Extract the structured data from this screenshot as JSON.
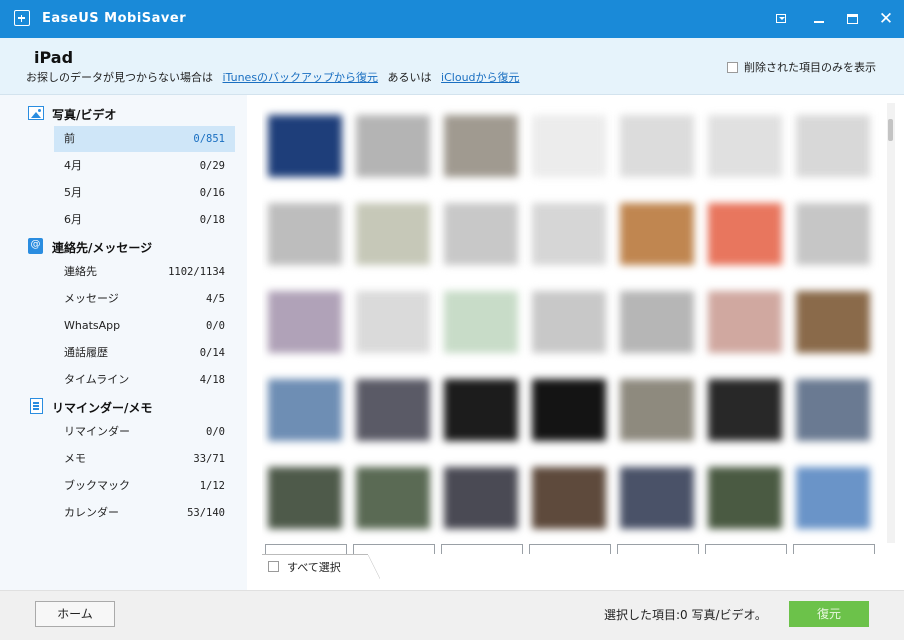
{
  "window": {
    "title": "EaseUS MobiSaver"
  },
  "header": {
    "device": "iPad",
    "hint_prefix": "お探しのデータが見つからない場合は",
    "itunes_link": "iTunesのバックアップから復元",
    "hint_middle": "あるいは",
    "icloud_link": "iCloudから復元",
    "deleted_only_label": "削除された項目のみを表示"
  },
  "sidebar": {
    "categories": [
      {
        "label": "写真/ビデオ",
        "icon": "photo-icon",
        "items": [
          {
            "label": "前",
            "count": "0/851"
          },
          {
            "label": "4月",
            "count": "0/29"
          },
          {
            "label": "5月",
            "count": "0/16"
          },
          {
            "label": "6月",
            "count": "0/18"
          }
        ]
      },
      {
        "label": "連絡先/メッセージ",
        "icon": "contact-icon",
        "items": [
          {
            "label": "連絡先",
            "count": "1102/1134"
          },
          {
            "label": "メッセージ",
            "count": "4/5"
          },
          {
            "label": "WhatsApp",
            "count": "0/0"
          },
          {
            "label": "通話履歴",
            "count": "0/14"
          },
          {
            "label": "タイムライン",
            "count": "4/18"
          }
        ]
      },
      {
        "label": "リマインダー/メモ",
        "icon": "memo-icon",
        "items": [
          {
            "label": "リマインダー",
            "count": "0/0"
          },
          {
            "label": "メモ",
            "count": "33/71"
          },
          {
            "label": "ブックマック",
            "count": "1/12"
          },
          {
            "label": "カレンダー",
            "count": "53/140"
          }
        ]
      }
    ]
  },
  "grid": {
    "thumbnail_colors": [
      [
        "#1e3e7a",
        "#b4b4b4",
        "#a09a90",
        "#ececec",
        "#dcdcdc",
        "#e0e0e0",
        "#d8d8d8"
      ],
      [
        "#bdbdbd",
        "#c6c8b8",
        "#c8c8c8",
        "#d6d6d6",
        "#c08650",
        "#e8765e",
        "#c6c6c6"
      ],
      [
        "#b0a2b8",
        "#dadada",
        "#c8dcc8",
        "#c8c8c8",
        "#b6b6b6",
        "#d0a8a0",
        "#8a6a4a"
      ],
      [
        "#6e8eb4",
        "#5a5a66",
        "#1c1c1c",
        "#141414",
        "#8e8a7e",
        "#282828",
        "#6a7a92"
      ],
      [
        "#4e5a4a",
        "#5a6a54",
        "#4a4a54",
        "#5e4a3c",
        "#4a5268",
        "#4a5a42",
        "#6a94c8"
      ]
    ],
    "select_all_label": "すべて選択"
  },
  "footer": {
    "home_label": "ホーム",
    "selection_status": "選択した項目:0 写真/ビデオ。",
    "recover_label": "復元"
  },
  "colors": {
    "titlebar": "#1a8ad8",
    "accent": "#1a6fc1",
    "recover": "#6cc24a"
  }
}
